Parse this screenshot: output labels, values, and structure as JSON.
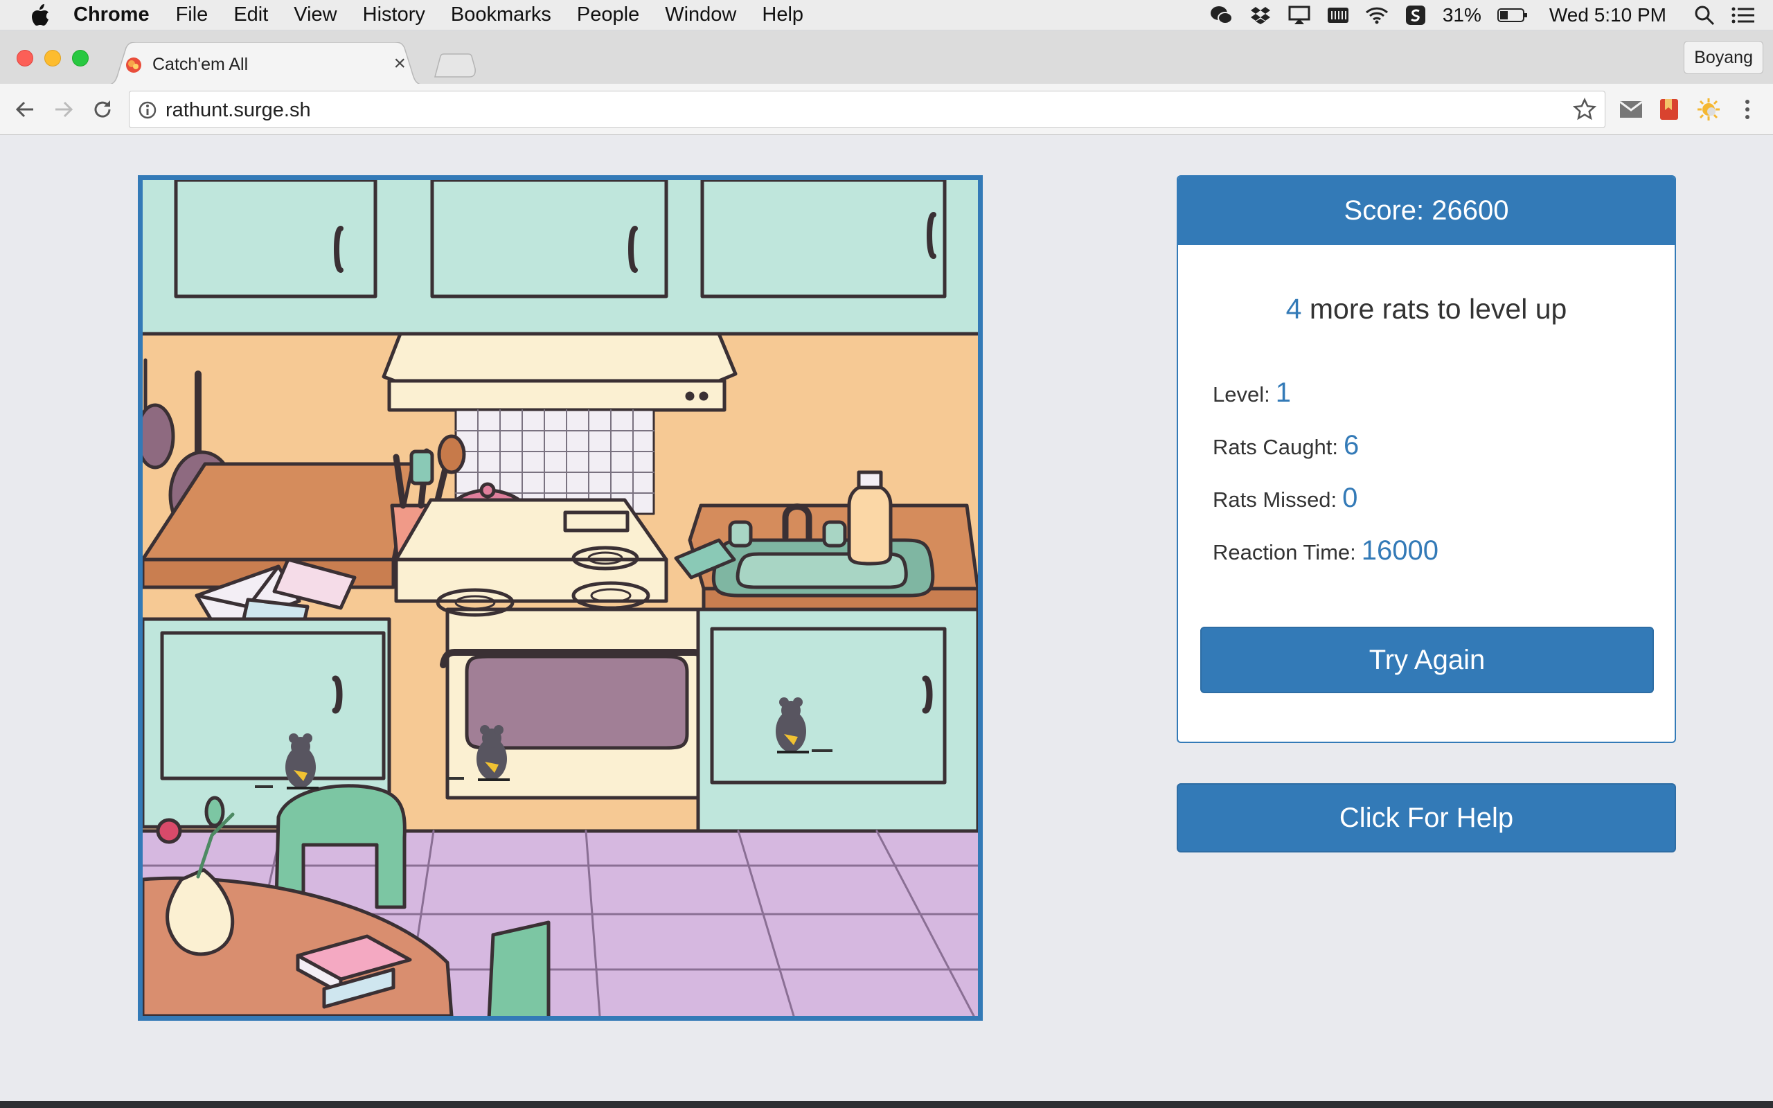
{
  "menubar": {
    "app": "Chrome",
    "items": [
      "File",
      "Edit",
      "View",
      "History",
      "Bookmarks",
      "People",
      "Window",
      "Help"
    ],
    "battery": "31%",
    "clock": "Wed 5:10 PM"
  },
  "browser": {
    "tab_title": "Catch'em All",
    "tab_close": "×",
    "profile": "Boyang",
    "url": "rathunt.surge.sh"
  },
  "game": {
    "rats_count": 3
  },
  "panel": {
    "score_label": "Score: 26600",
    "rats_to_level": "4",
    "level_up_text": "more rats to level up",
    "level_label": "Level:",
    "level_value": "1",
    "caught_label": "Rats Caught:",
    "caught_value": "6",
    "missed_label": "Rats Missed:",
    "missed_value": "0",
    "reaction_label": "Reaction Time:",
    "reaction_value": "16000",
    "try_again": "Try Again"
  },
  "help_button": "Click For Help",
  "colors": {
    "primary": "#337ab7",
    "page_bg": "#e9eaee"
  }
}
